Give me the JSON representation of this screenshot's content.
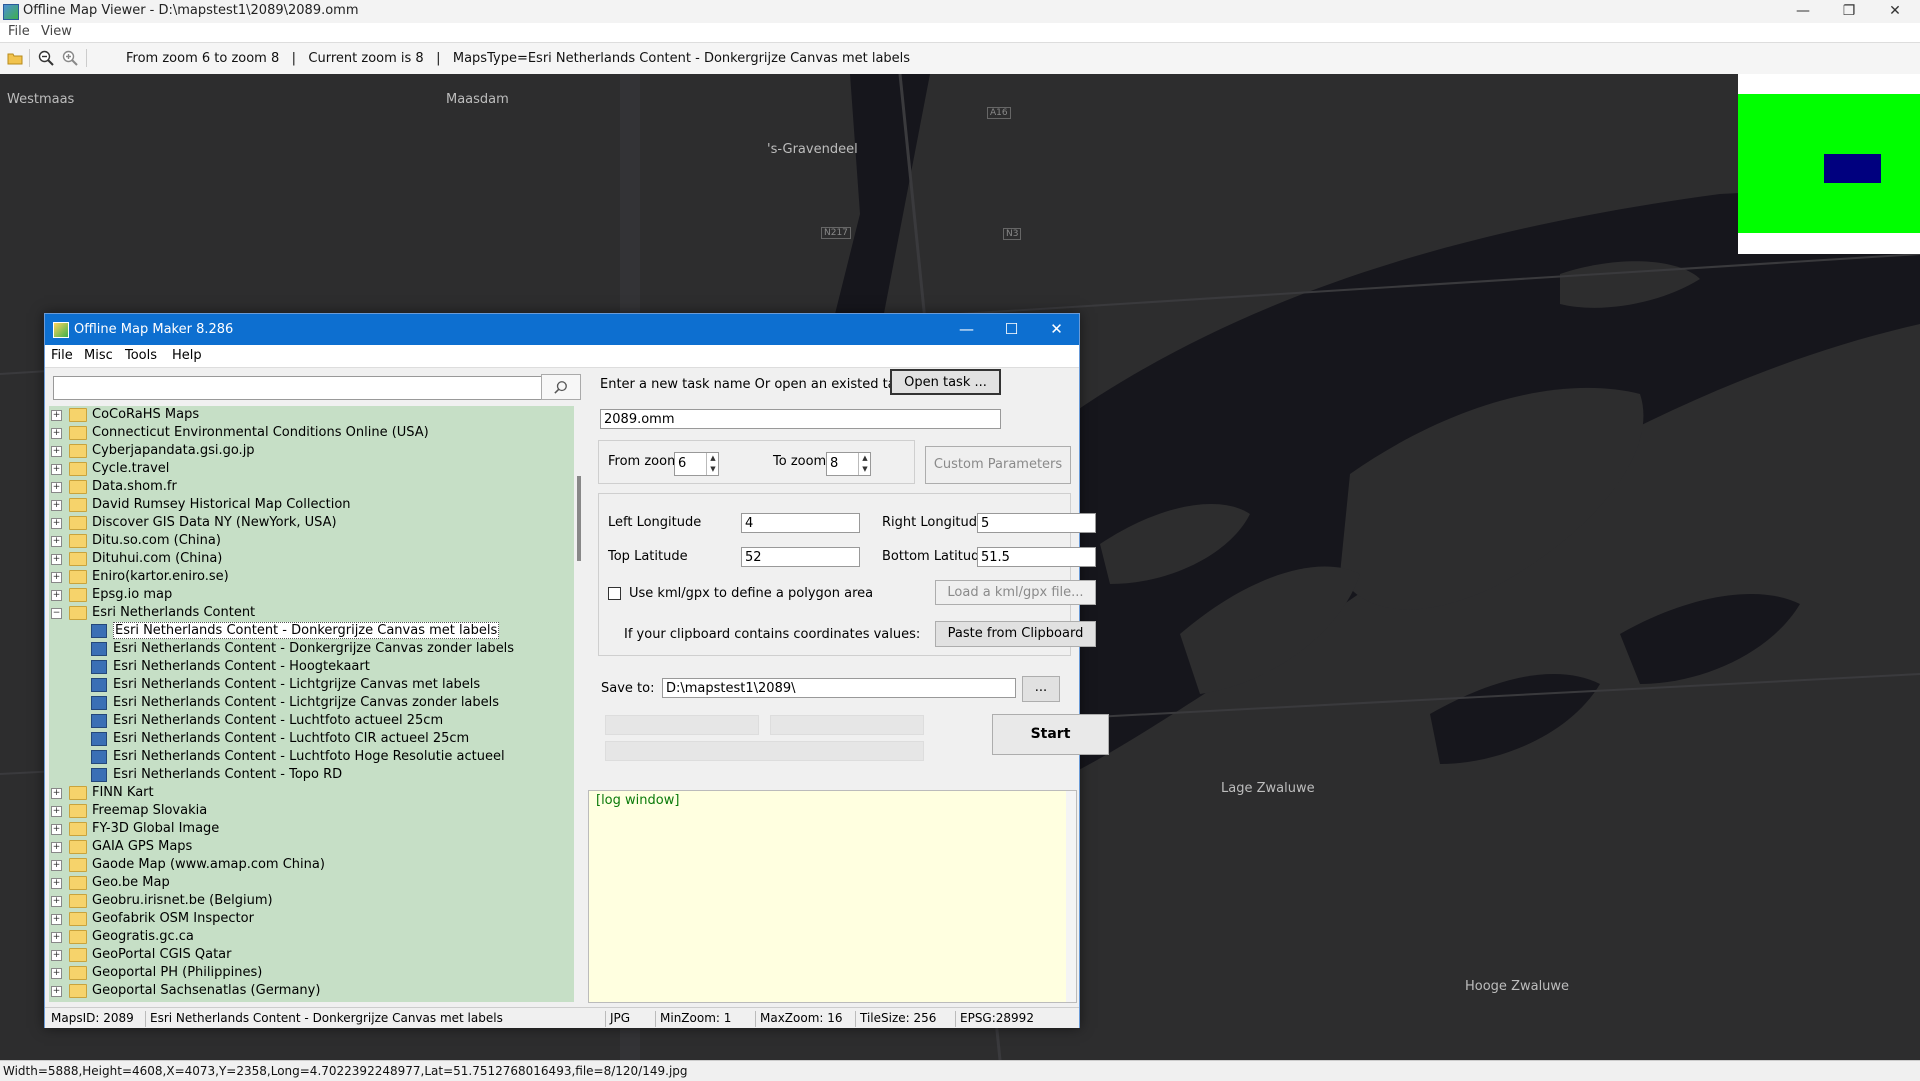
{
  "viewer": {
    "title": "Offline Map Viewer - D:\\mapstest1\\2089\\2089.omm",
    "menu": [
      "File",
      "View"
    ],
    "toolbar_status": "From zoom 6 to zoom 8   |   Current zoom is 8   |   MapsType=Esri Netherlands Content - Donkergrijze Canvas met labels",
    "statusbar": "Width=5888,Height=4608,X=4073,Y=2358,Long=4.7022392248977,Lat=51.7512768016493,file=8/120/149.jpg",
    "map_labels": [
      "Westmaas",
      "Maasdam",
      "'s-Gravendeel",
      "Lage Zwaluwe",
      "Hooge Zwaluwe"
    ],
    "road_labels": [
      "A16",
      "N217",
      "N3"
    ]
  },
  "maker": {
    "title": "Offline Map Maker 8.286",
    "menu": [
      "File",
      "Misc",
      "Tools",
      "Help"
    ],
    "search": {
      "value": "",
      "placeholder": ""
    },
    "tree": [
      {
        "label": "CoCoRaHS Maps",
        "type": "folder",
        "expanded": false
      },
      {
        "label": "Connecticut Environmental Conditions Online (USA)",
        "type": "folder",
        "expanded": false
      },
      {
        "label": "Cyberjapandata.gsi.go.jp",
        "type": "folder",
        "expanded": false
      },
      {
        "label": "Cycle.travel",
        "type": "folder",
        "expanded": false
      },
      {
        "label": "Data.shom.fr",
        "type": "folder",
        "expanded": false
      },
      {
        "label": "David Rumsey Historical Map Collection",
        "type": "folder",
        "expanded": false
      },
      {
        "label": "Discover GIS Data NY (NewYork, USA)",
        "type": "folder",
        "expanded": false
      },
      {
        "label": "Ditu.so.com (China)",
        "type": "folder",
        "expanded": false
      },
      {
        "label": "Dituhui.com (China)",
        "type": "folder",
        "expanded": false
      },
      {
        "label": "Eniro(kartor.eniro.se)",
        "type": "folder",
        "expanded": false
      },
      {
        "label": "Epsg.io map",
        "type": "folder",
        "expanded": false
      },
      {
        "label": "Esri Netherlands Content",
        "type": "folder",
        "expanded": true
      },
      {
        "label": "Esri Netherlands Content - Donkergrijze Canvas met labels",
        "type": "map",
        "selected": true
      },
      {
        "label": "Esri Netherlands Content - Donkergrijze Canvas zonder labels",
        "type": "map"
      },
      {
        "label": "Esri Netherlands Content - Hoogtekaart",
        "type": "map"
      },
      {
        "label": "Esri Netherlands Content - Lichtgrijze Canvas met labels",
        "type": "map"
      },
      {
        "label": "Esri Netherlands Content - Lichtgrijze Canvas zonder labels",
        "type": "map"
      },
      {
        "label": "Esri Netherlands Content - Luchtfoto actueel 25cm",
        "type": "map"
      },
      {
        "label": "Esri Netherlands Content - Luchtfoto CIR actueel 25cm",
        "type": "map"
      },
      {
        "label": "Esri Netherlands Content - Luchtfoto Hoge Resolutie actueel",
        "type": "map"
      },
      {
        "label": "Esri Netherlands Content - Topo RD",
        "type": "map"
      },
      {
        "label": "FINN Kart",
        "type": "folder",
        "expanded": false
      },
      {
        "label": "Freemap Slovakia",
        "type": "folder",
        "expanded": false
      },
      {
        "label": "FY-3D Global Image",
        "type": "folder",
        "expanded": false
      },
      {
        "label": "GAIA GPS Maps",
        "type": "folder",
        "expanded": false
      },
      {
        "label": "Gaode Map (www.amap.com China)",
        "type": "folder",
        "expanded": false
      },
      {
        "label": "Geo.be Map",
        "type": "folder",
        "expanded": false
      },
      {
        "label": "Geobru.irisnet.be (Belgium)",
        "type": "folder",
        "expanded": false
      },
      {
        "label": "Geofabrik OSM Inspector",
        "type": "folder",
        "expanded": false
      },
      {
        "label": "Geogratis.gc.ca",
        "type": "folder",
        "expanded": false
      },
      {
        "label": "GeoPortal CGIS Qatar",
        "type": "folder",
        "expanded": false
      },
      {
        "label": "Geoportal PH (Philippines)",
        "type": "folder",
        "expanded": false
      },
      {
        "label": "Geoportal Sachsenatlas (Germany)",
        "type": "folder",
        "expanded": false
      }
    ],
    "task": {
      "prompt": "Enter a new task name Or open an existed task to continue:",
      "open_button": "Open task ...",
      "name_value": "2089.omm"
    },
    "zoom": {
      "from_label": "From zoom",
      "from_value": "6",
      "to_label": "To zoom",
      "to_value": "8",
      "custom_button": "Custom Parameters"
    },
    "bounds": {
      "left_label": "Left Longitude",
      "left_value": "4",
      "right_label": "Right Longitude",
      "right_value": "5",
      "top_label": "Top Latitude",
      "top_value": "52",
      "bottom_label": "Bottom Latitude",
      "bottom_value": "51.5",
      "kml_checkbox_label": "Use kml/gpx to define a polygon area",
      "kml_button": "Load a kml/gpx file...",
      "clipboard_label": "If your clipboard contains coordinates values:",
      "clipboard_button": "Paste from Clipboard"
    },
    "save": {
      "label": "Save to:",
      "value": "D:\\mapstest1\\2089\\",
      "browse_button": "..."
    },
    "start_button": "Start",
    "log_text": "[log window]",
    "statusbar": {
      "maps_id": "MapsID: 2089",
      "maps_name": "Esri Netherlands Content - Donkergrijze Canvas met labels",
      "format": "JPG",
      "min_zoom": "MinZoom: 1",
      "max_zoom": "MaxZoom: 16",
      "tile_size": "TileSize: 256",
      "epsg": "EPSG:28992"
    }
  },
  "colors": {
    "map_background": "#2d2d2e",
    "water": "#16161c",
    "tree_background": "#c6dfc6",
    "log_background": "#ffffe0",
    "maker_titlebar": "#0d6fd0",
    "minimap_green": "#00ff00",
    "minimap_viewport": "#00007f"
  }
}
